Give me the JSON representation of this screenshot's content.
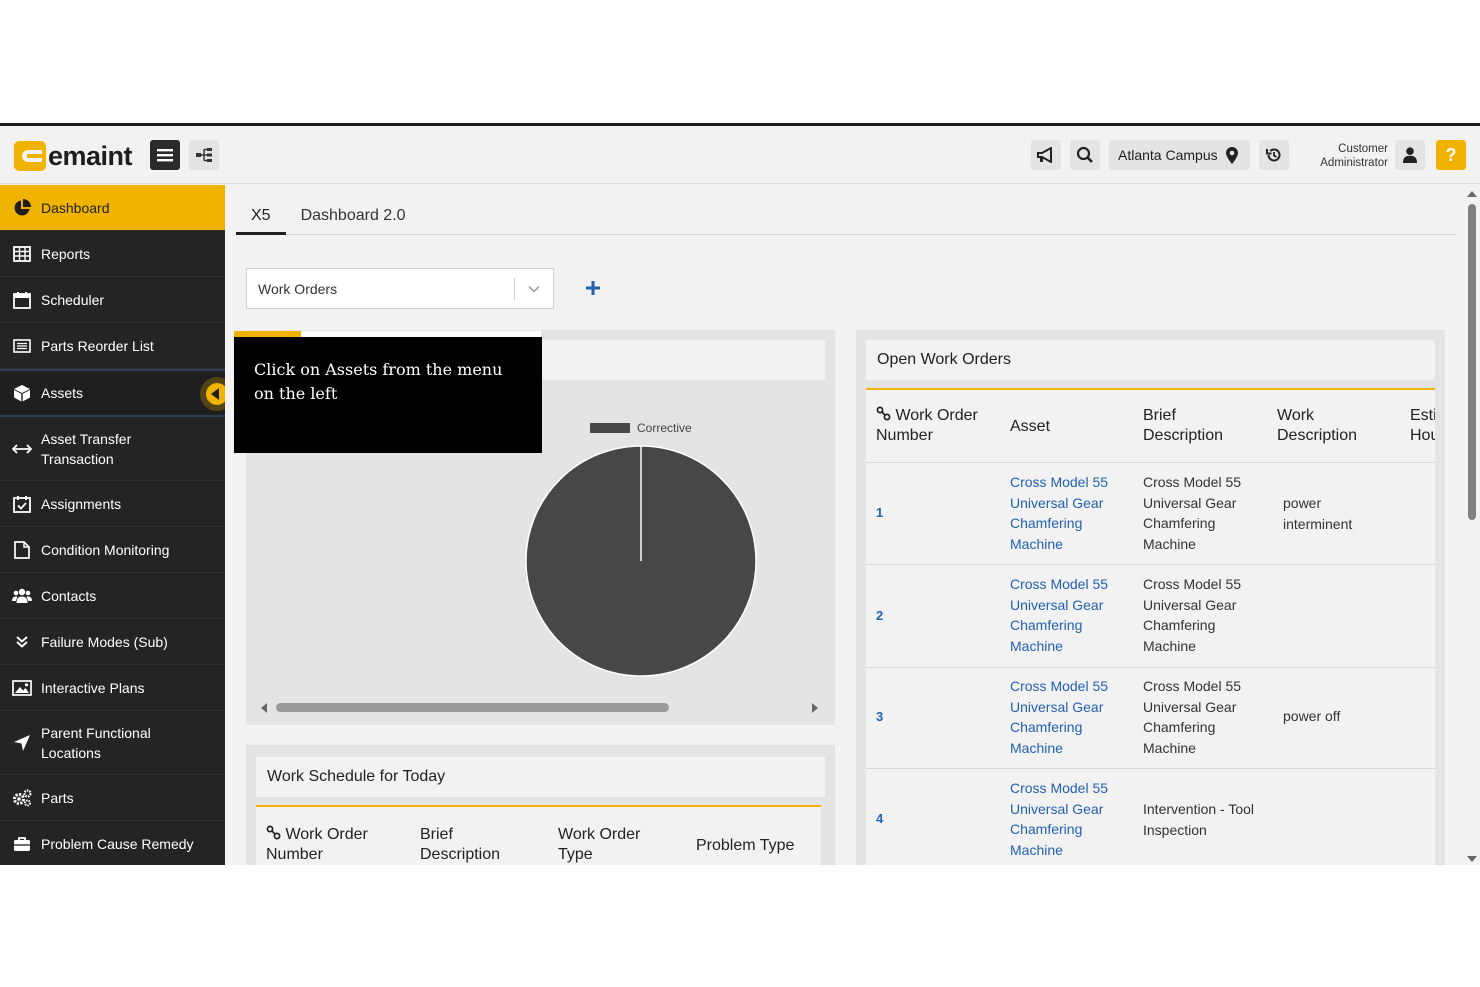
{
  "header": {
    "logo_text": "emaint",
    "campus": "Atlanta Campus",
    "user_role_line1": "Customer",
    "user_role_line2": "Administrator",
    "help_label": "?"
  },
  "sidebar": {
    "items": [
      {
        "label": "Dashboard",
        "icon": "pie-chart-icon"
      },
      {
        "label": "Reports",
        "icon": "table-icon"
      },
      {
        "label": "Scheduler",
        "icon": "calendar-icon"
      },
      {
        "label": "Parts Reorder List",
        "icon": "list-icon"
      },
      {
        "label": "Assets",
        "icon": "cube-icon"
      },
      {
        "label": "Asset Transfer Transaction",
        "icon": "transfer-arrows-icon"
      },
      {
        "label": "Assignments",
        "icon": "calendar-check-icon"
      },
      {
        "label": "Condition Monitoring",
        "icon": "document-icon"
      },
      {
        "label": "Contacts",
        "icon": "users-icon"
      },
      {
        "label": "Failure Modes (Sub)",
        "icon": "double-chevron-down-icon"
      },
      {
        "label": "Interactive Plans",
        "icon": "image-icon"
      },
      {
        "label": "Parent Functional Locations",
        "icon": "location-arrow-icon"
      },
      {
        "label": "Parts",
        "icon": "gears-icon"
      },
      {
        "label": "Problem Cause Remedy",
        "icon": "briefcase-icon"
      }
    ]
  },
  "tabs": [
    {
      "label": "X5"
    },
    {
      "label": "Dashboard 2.0"
    }
  ],
  "widget_select": {
    "value": "Work Orders"
  },
  "tour_tooltip": {
    "text": "Click on Assets from the menu on the left"
  },
  "chart_data": {
    "type": "pie",
    "title": "",
    "categories": [
      "Corrective"
    ],
    "values": [
      100
    ],
    "legend": "top-right",
    "colors": [
      "#474747"
    ]
  },
  "work_schedule": {
    "title": "Work Schedule for Today",
    "columns": [
      "Work Order Number",
      "Brief Description",
      "Work Order Type",
      "Problem Type"
    ]
  },
  "open_work_orders": {
    "title": "Open Work Orders",
    "columns": [
      "Work Order Number",
      "Asset",
      "Brief Description",
      "Work Description",
      "Esti Hou"
    ],
    "rows": [
      {
        "number": "1",
        "asset": "Cross Model 55 Universal Gear Chamfering Machine",
        "brief": "Cross Model 55 Universal Gear Chamfering Machine",
        "work": "power interminent"
      },
      {
        "number": "2",
        "asset": "Cross Model 55 Universal Gear Chamfering Machine",
        "brief": "Cross Model 55 Universal Gear Chamfering Machine",
        "work": ""
      },
      {
        "number": "3",
        "asset": "Cross Model 55 Universal Gear Chamfering Machine",
        "brief": "Cross Model 55 Universal Gear Chamfering Machine",
        "work": "power off"
      },
      {
        "number": "4",
        "asset": "Cross Model 55 Universal Gear Chamfering Machine",
        "brief": "Intervention - Tool Inspection",
        "work": ""
      }
    ]
  }
}
